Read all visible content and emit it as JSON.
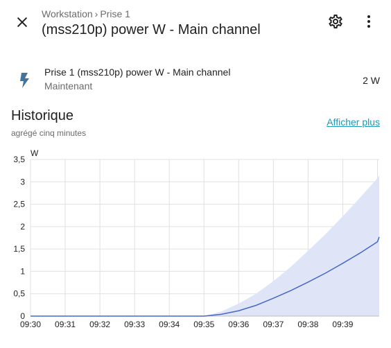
{
  "header": {
    "breadcrumb": [
      "Workstation",
      "Prise 1"
    ],
    "breadcrumb_separator": "›",
    "title": "(mss210p) power W - Main channel",
    "icons": {
      "close": "close-icon",
      "settings": "gear-icon",
      "menu": "dots-vertical-icon"
    }
  },
  "entity": {
    "name": "Prise 1 (mss210p) power W - Main channel",
    "time": "Maintenant",
    "value": "2 W",
    "icon": "flash-icon",
    "icon_color": "#44739e"
  },
  "history": {
    "title": "Historique",
    "subtitle": "agrégé cinq minutes",
    "show_more": "Afficher plus",
    "link_color": "#1a9ab8"
  },
  "chart_data": {
    "type": "line",
    "ylabel": "W",
    "ylim": [
      0,
      3.5
    ],
    "yticks": [
      "0",
      "0,5",
      "1",
      "1,5",
      "2",
      "2,5",
      "3",
      "3,5"
    ],
    "xticks": [
      "09:30",
      "09:31",
      "09:32",
      "09:33",
      "09:34",
      "09:35",
      "09:36",
      "09:37",
      "09:38",
      "09:39"
    ],
    "grid": true,
    "line_color": "#4468c8",
    "band_color": "#dfe5f7",
    "series": [
      {
        "values": [
          {
            "t": 0.0,
            "mean": 0,
            "max": 0
          },
          {
            "t": 1.0,
            "mean": 0,
            "max": 0
          },
          {
            "t": 2.0,
            "mean": 0,
            "max": 0
          },
          {
            "t": 3.0,
            "mean": 0,
            "max": 0
          },
          {
            "t": 4.0,
            "mean": 0,
            "max": 0
          },
          {
            "t": 5.0,
            "mean": 0,
            "max": 0
          },
          {
            "t": 5.5,
            "mean": 0.04,
            "max": 0.1
          },
          {
            "t": 6.0,
            "mean": 0.12,
            "max": 0.28
          },
          {
            "t": 6.5,
            "mean": 0.24,
            "max": 0.5
          },
          {
            "t": 7.0,
            "mean": 0.4,
            "max": 0.78
          },
          {
            "t": 7.5,
            "mean": 0.57,
            "max": 1.1
          },
          {
            "t": 8.0,
            "mean": 0.76,
            "max": 1.46
          },
          {
            "t": 8.5,
            "mean": 0.96,
            "max": 1.83
          },
          {
            "t": 9.0,
            "mean": 1.18,
            "max": 2.23
          },
          {
            "t": 9.5,
            "mean": 1.41,
            "max": 2.65
          },
          {
            "t": 10.0,
            "mean": 1.66,
            "max": 3.08
          },
          {
            "t": 10.05,
            "mean": 1.77,
            "max": 3.15
          }
        ]
      }
    ]
  }
}
